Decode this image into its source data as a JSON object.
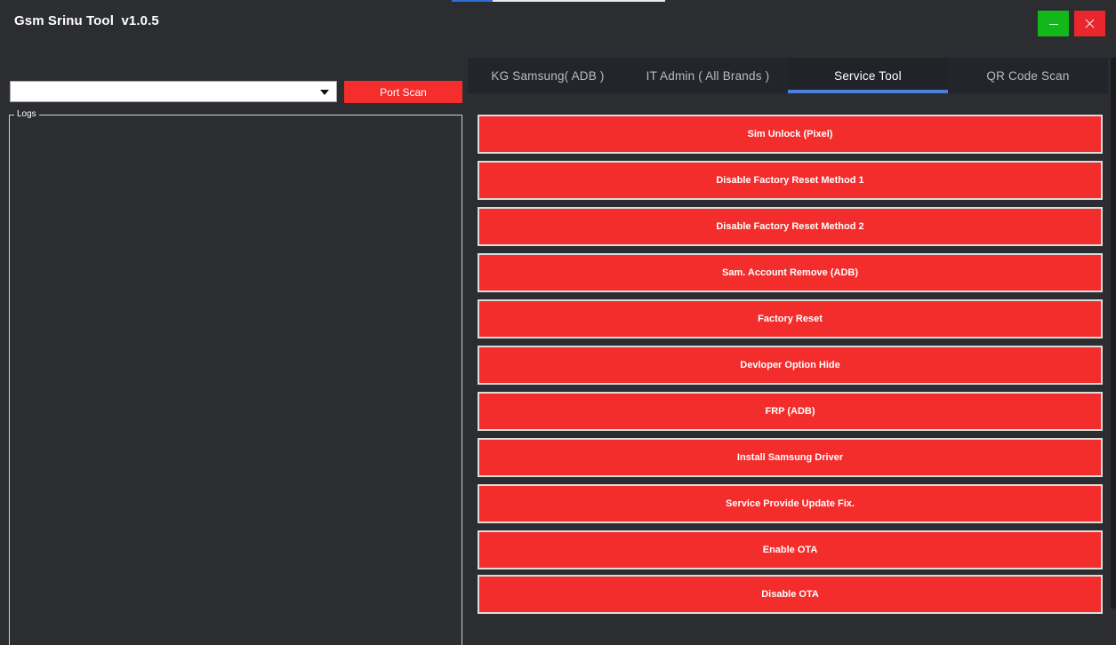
{
  "window": {
    "title": "Gsm Srinu Tool  v1.0.5",
    "minimize_icon": "minimize-icon",
    "close_icon": "close-icon",
    "minimize_color": "#12b81a",
    "close_color": "#e8262b"
  },
  "port": {
    "selected_value": "",
    "scan_label": "Port Scan"
  },
  "logs": {
    "label": "Logs"
  },
  "tabs": [
    {
      "label": "KG Samsung( ADB )"
    },
    {
      "label": "IT Admin ( All Brands )"
    },
    {
      "label": "Service Tool"
    },
    {
      "label": "QR Code Scan"
    }
  ],
  "active_tab": "Service Tool",
  "service_buttons": [
    {
      "label": "Sim Unlock (Pixel)"
    },
    {
      "label": "Disable Factory Reset Method 1"
    },
    {
      "label": "Disable Factory Reset Method 2"
    },
    {
      "label": "Sam. Account Remove (ADB)"
    },
    {
      "label": "Factory Reset"
    },
    {
      "label": "Devloper Option Hide"
    },
    {
      "label": "FRP (ADB)"
    },
    {
      "label": "Install Samsung Driver"
    },
    {
      "label": "Service Provide Update Fix."
    },
    {
      "label": "Enable OTA"
    },
    {
      "label": "Disable OTA"
    }
  ],
  "colors": {
    "background": "#2b2d31",
    "accent_red": "#f32c2c",
    "active_tab_underline": "#4a7fe0"
  }
}
